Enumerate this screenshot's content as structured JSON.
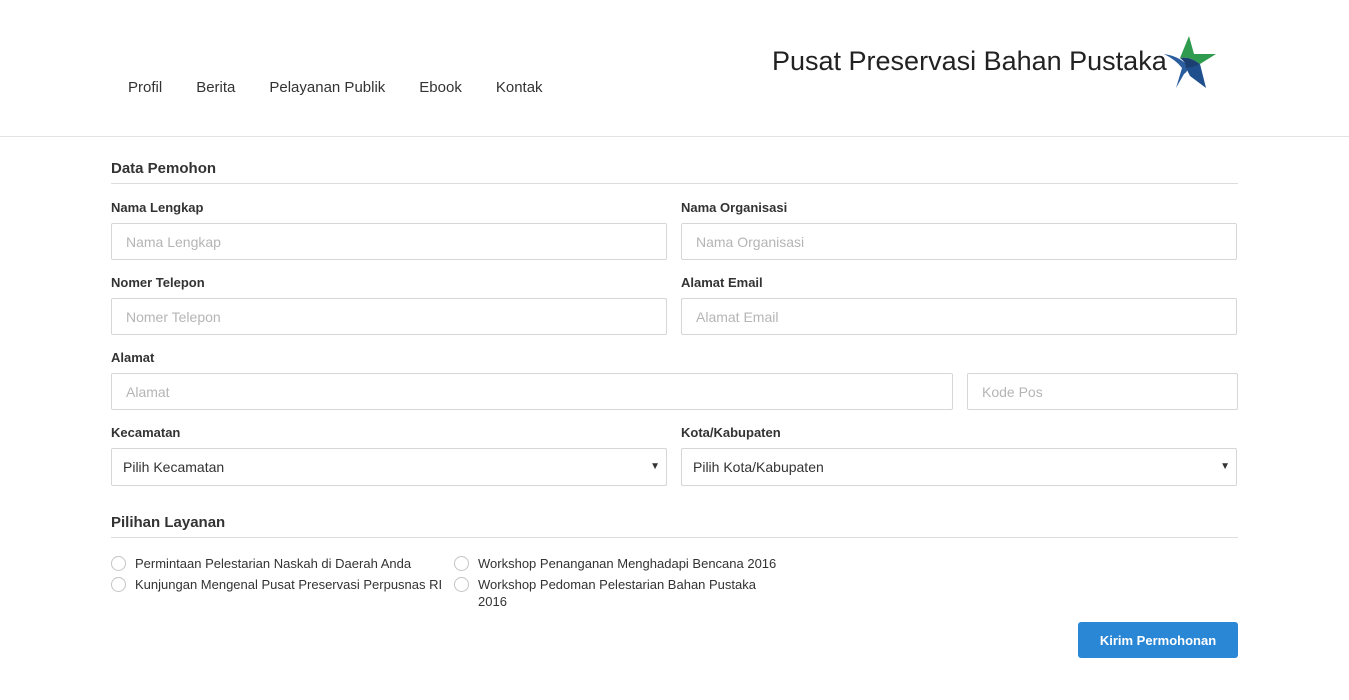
{
  "nav": {
    "items": [
      {
        "label": "Profil"
      },
      {
        "label": "Berita"
      },
      {
        "label": "Pelayanan Publik"
      },
      {
        "label": "Ebook"
      },
      {
        "label": "Kontak"
      }
    ]
  },
  "site_title": "Pusat Preservasi Bahan Pustaka",
  "logo_icon": "star-logo-icon",
  "colors": {
    "accent": "#2a87d6",
    "logo_green": "#2e9b4f",
    "logo_blue": "#2a5d9e"
  },
  "form": {
    "section_title": "Data Pemohon",
    "nama_lengkap": {
      "label": "Nama Lengkap",
      "placeholder": "Nama Lengkap",
      "value": ""
    },
    "nama_organisasi": {
      "label": "Nama Organisasi",
      "placeholder": "Nama Organisasi",
      "value": ""
    },
    "nomer_telepon": {
      "label": "Nomer Telepon",
      "placeholder": "Nomer Telepon",
      "value": ""
    },
    "alamat_email": {
      "label": "Alamat Email",
      "placeholder": "Alamat Email",
      "value": ""
    },
    "alamat": {
      "label": "Alamat",
      "placeholder": "Alamat",
      "value": ""
    },
    "kode_pos": {
      "placeholder": "Kode Pos",
      "value": ""
    },
    "kecamatan": {
      "label": "Kecamatan",
      "selected": "Pilih Kecamatan"
    },
    "kota": {
      "label": "Kota/Kabupaten",
      "selected": "Pilih Kota/Kabupaten"
    },
    "chevron_glyph": "▼"
  },
  "services": {
    "title": "Pilihan Layanan",
    "left": [
      {
        "label": "Permintaan Pelestarian Naskah di Daerah Anda"
      },
      {
        "label": "Kunjungan Mengenal Pusat Preservasi Perpusnas RI"
      }
    ],
    "right": [
      {
        "label": "Workshop Penanganan Menghadapi Bencana 2016"
      },
      {
        "label": "Workshop Pedoman Pelestarian Bahan Pustaka 2016"
      }
    ]
  },
  "submit_label": "Kirim Permohonan"
}
